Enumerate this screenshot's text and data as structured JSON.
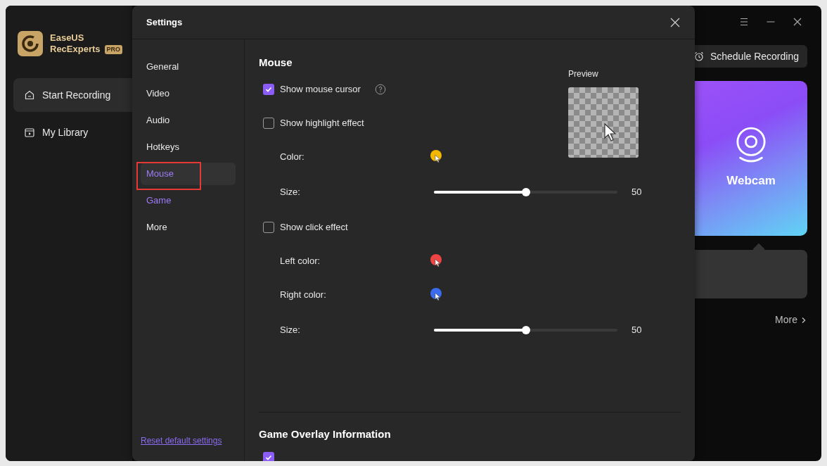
{
  "app": {
    "name_line1": "EaseUS",
    "name_line2": "RecExperts",
    "badge": "PRO"
  },
  "sidebar": {
    "items": [
      {
        "label": "Start Recording",
        "selected": true
      },
      {
        "label": "My Library",
        "selected": false
      }
    ]
  },
  "main": {
    "schedule_button": "Schedule Recording",
    "card_title": "Webcam",
    "more_link": "More"
  },
  "settings": {
    "title": "Settings",
    "nav": [
      {
        "label": "General",
        "selected": false,
        "accent": false,
        "annotated": false
      },
      {
        "label": "Video",
        "selected": false,
        "accent": false,
        "annotated": false
      },
      {
        "label": "Audio",
        "selected": false,
        "accent": false,
        "annotated": false
      },
      {
        "label": "Hotkeys",
        "selected": false,
        "accent": false,
        "annotated": false
      },
      {
        "label": "Mouse",
        "selected": true,
        "accent": false,
        "annotated": true
      },
      {
        "label": "Game",
        "selected": false,
        "accent": true,
        "annotated": false
      },
      {
        "label": "More",
        "selected": false,
        "accent": false,
        "annotated": false
      }
    ],
    "reset_link": "Reset default settings",
    "section_title": "Mouse",
    "preview_label": "Preview",
    "rows": [
      {
        "kind": "checkbox",
        "label": "Show mouse cursor",
        "checked": true,
        "help": true
      },
      {
        "kind": "checkbox",
        "label": "Show highlight effect",
        "checked": false,
        "help": false
      },
      {
        "kind": "color",
        "label": "Color:",
        "color": "#f5b800"
      },
      {
        "kind": "slider",
        "label": "Size:",
        "level": 0.5,
        "reading": "50"
      },
      {
        "kind": "checkbox",
        "label": "Show click effect",
        "checked": false,
        "help": false
      },
      {
        "kind": "color",
        "label": "Left color:",
        "color": "#ef4444"
      },
      {
        "kind": "color",
        "label": "Right color:",
        "color": "#3b6cf0"
      },
      {
        "kind": "slider",
        "label": "Size:",
        "level": 0.5,
        "reading": "50"
      }
    ],
    "game_section_title": "Game Overlay Information",
    "game_first_checked": true
  }
}
